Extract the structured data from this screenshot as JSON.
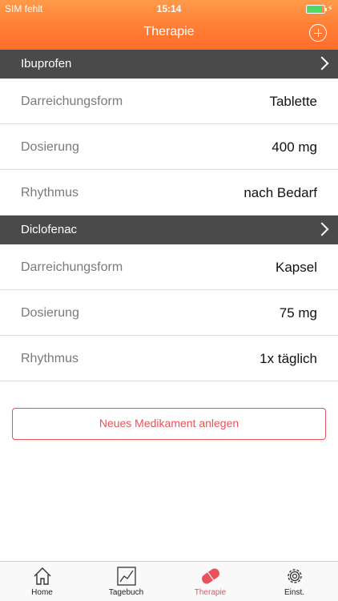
{
  "status_bar": {
    "carrier": "SIM fehlt",
    "time": "15:14"
  },
  "nav": {
    "title": "Therapie"
  },
  "medications": [
    {
      "name": "Ibuprofen",
      "rows": [
        {
          "label": "Darreichungsform",
          "value": "Tablette"
        },
        {
          "label": "Dosierung",
          "value": "400 mg"
        },
        {
          "label": "Rhythmus",
          "value": "nach Bedarf"
        }
      ]
    },
    {
      "name": "Diclofenac",
      "rows": [
        {
          "label": "Darreichungsform",
          "value": "Kapsel"
        },
        {
          "label": "Dosierung",
          "value": "75 mg"
        },
        {
          "label": "Rhythmus",
          "value": "1x täglich"
        }
      ]
    }
  ],
  "actions": {
    "new_medication": "Neues Medikament anlegen"
  },
  "tabbar": {
    "items": [
      {
        "label": "Home",
        "icon": "house-icon"
      },
      {
        "label": "Tagebuch",
        "icon": "chart-icon"
      },
      {
        "label": "Therapie",
        "icon": "pill-icon",
        "active": true
      },
      {
        "label": "Einst.",
        "icon": "gear-icon"
      }
    ]
  },
  "colors": {
    "header": "#ff7b33",
    "section": "#4a4a4a",
    "accent": "#e9525a"
  }
}
